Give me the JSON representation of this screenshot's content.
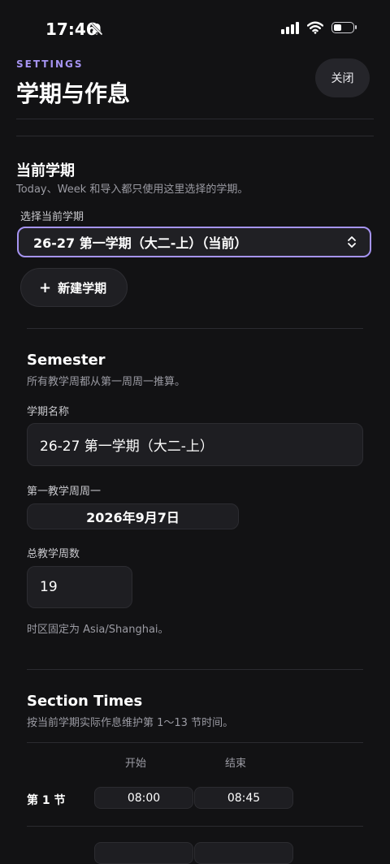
{
  "status_bar": {
    "time": "17:46",
    "icons": [
      "bell-slash-icon",
      "signal-icon",
      "wifi-icon",
      "battery-icon"
    ]
  },
  "header": {
    "kicker": "SETTINGS",
    "title": "学期与作息",
    "close_label": "关闭"
  },
  "current_semester": {
    "heading": "当前学期",
    "description": "Today、Week 和导入都只使用这里选择的学期。",
    "select_label": "选择当前学期",
    "selected_value": "26-27 第一学期（大二-上）（当前）",
    "new_button_label": "新建学期"
  },
  "semester": {
    "heading": "Semester",
    "description": "所有教学周都从第一周周一推算。",
    "name_label": "学期名称",
    "name_value": "26-27 第一学期（大二-上）",
    "start_label": "第一教学周周一",
    "start_value": "2026年9月7日",
    "weeks_label": "总教学周数",
    "weeks_value": "19",
    "timezone_note": "时区固定为 Asia/Shanghai。"
  },
  "section_times": {
    "heading": "Section Times",
    "description": "按当前学期实际作息维护第 1～13 节时间。",
    "col_start": "开始",
    "col_end": "结束",
    "rows": [
      {
        "label": "第 1 节",
        "start": "08:00",
        "end": "08:45"
      }
    ]
  },
  "colors": {
    "accent": "#a694f2",
    "background": "#121214",
    "surface": "#1e1e22"
  }
}
